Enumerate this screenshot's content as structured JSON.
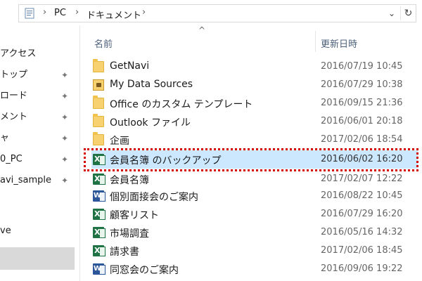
{
  "address_bar": {
    "crumbs": [
      "PC",
      "ドキュメント"
    ],
    "dropdown_glyph": "⌄",
    "refresh_glyph": "↻"
  },
  "nav": {
    "items": [
      {
        "label": "アクセス",
        "pinned": false
      },
      {
        "label": "トップ",
        "pinned": true
      },
      {
        "label": "ロード",
        "pinned": true
      },
      {
        "label": "メント",
        "pinned": true
      },
      {
        "label": "ャ",
        "pinned": true
      },
      {
        "label": "0_PC",
        "pinned": true
      },
      {
        "label": "avi_sample",
        "pinned": true
      },
      {
        "label": "",
        "pinned": false
      },
      {
        "label": "ve",
        "pinned": false
      }
    ]
  },
  "columns": {
    "name": "名前",
    "date": "更新日時"
  },
  "files": [
    {
      "name": "GetNavi",
      "date": "2016/07/19 10:45",
      "icon": "folder-icon",
      "selected": false
    },
    {
      "name": "My Data Sources",
      "date": "2016/07/29 10:38",
      "icon": "data-sources-folder-icon",
      "selected": false
    },
    {
      "name": "Office のカスタム テンプレート",
      "date": "2016/09/15 21:36",
      "icon": "folder-icon",
      "selected": false
    },
    {
      "name": "Outlook ファイル",
      "date": "2016/06/01 20:18",
      "icon": "folder-icon",
      "selected": false
    },
    {
      "name": "企画",
      "date": "2017/02/06 18:54",
      "icon": "folder-icon",
      "selected": false
    },
    {
      "name": "会員名簿 のバックアップ",
      "date": "2016/06/02 16:20",
      "icon": "excel-file-icon",
      "selected": true
    },
    {
      "name": "会員名簿",
      "date": "2017/02/07 12:22",
      "icon": "excel-file-icon",
      "selected": false
    },
    {
      "name": "個別面接会のご案内",
      "date": "2016/08/22 10:45",
      "icon": "word-file-icon",
      "selected": false
    },
    {
      "name": "顧客リスト",
      "date": "2016/07/29 16:20",
      "icon": "excel-file-icon",
      "selected": false
    },
    {
      "name": "市場調査",
      "date": "2016/05/16 14:32",
      "icon": "excel-file-icon",
      "selected": false
    },
    {
      "name": "請求書",
      "date": "2017/02/06 18:45",
      "icon": "excel-file-icon",
      "selected": false
    },
    {
      "name": "同窓会のご案内",
      "date": "2016/09/06 19:22",
      "icon": "word-file-icon",
      "selected": false
    }
  ],
  "colors": {
    "selection": "#cce8ff",
    "highlight_border": "#d60000",
    "header_text": "#4c607a"
  }
}
